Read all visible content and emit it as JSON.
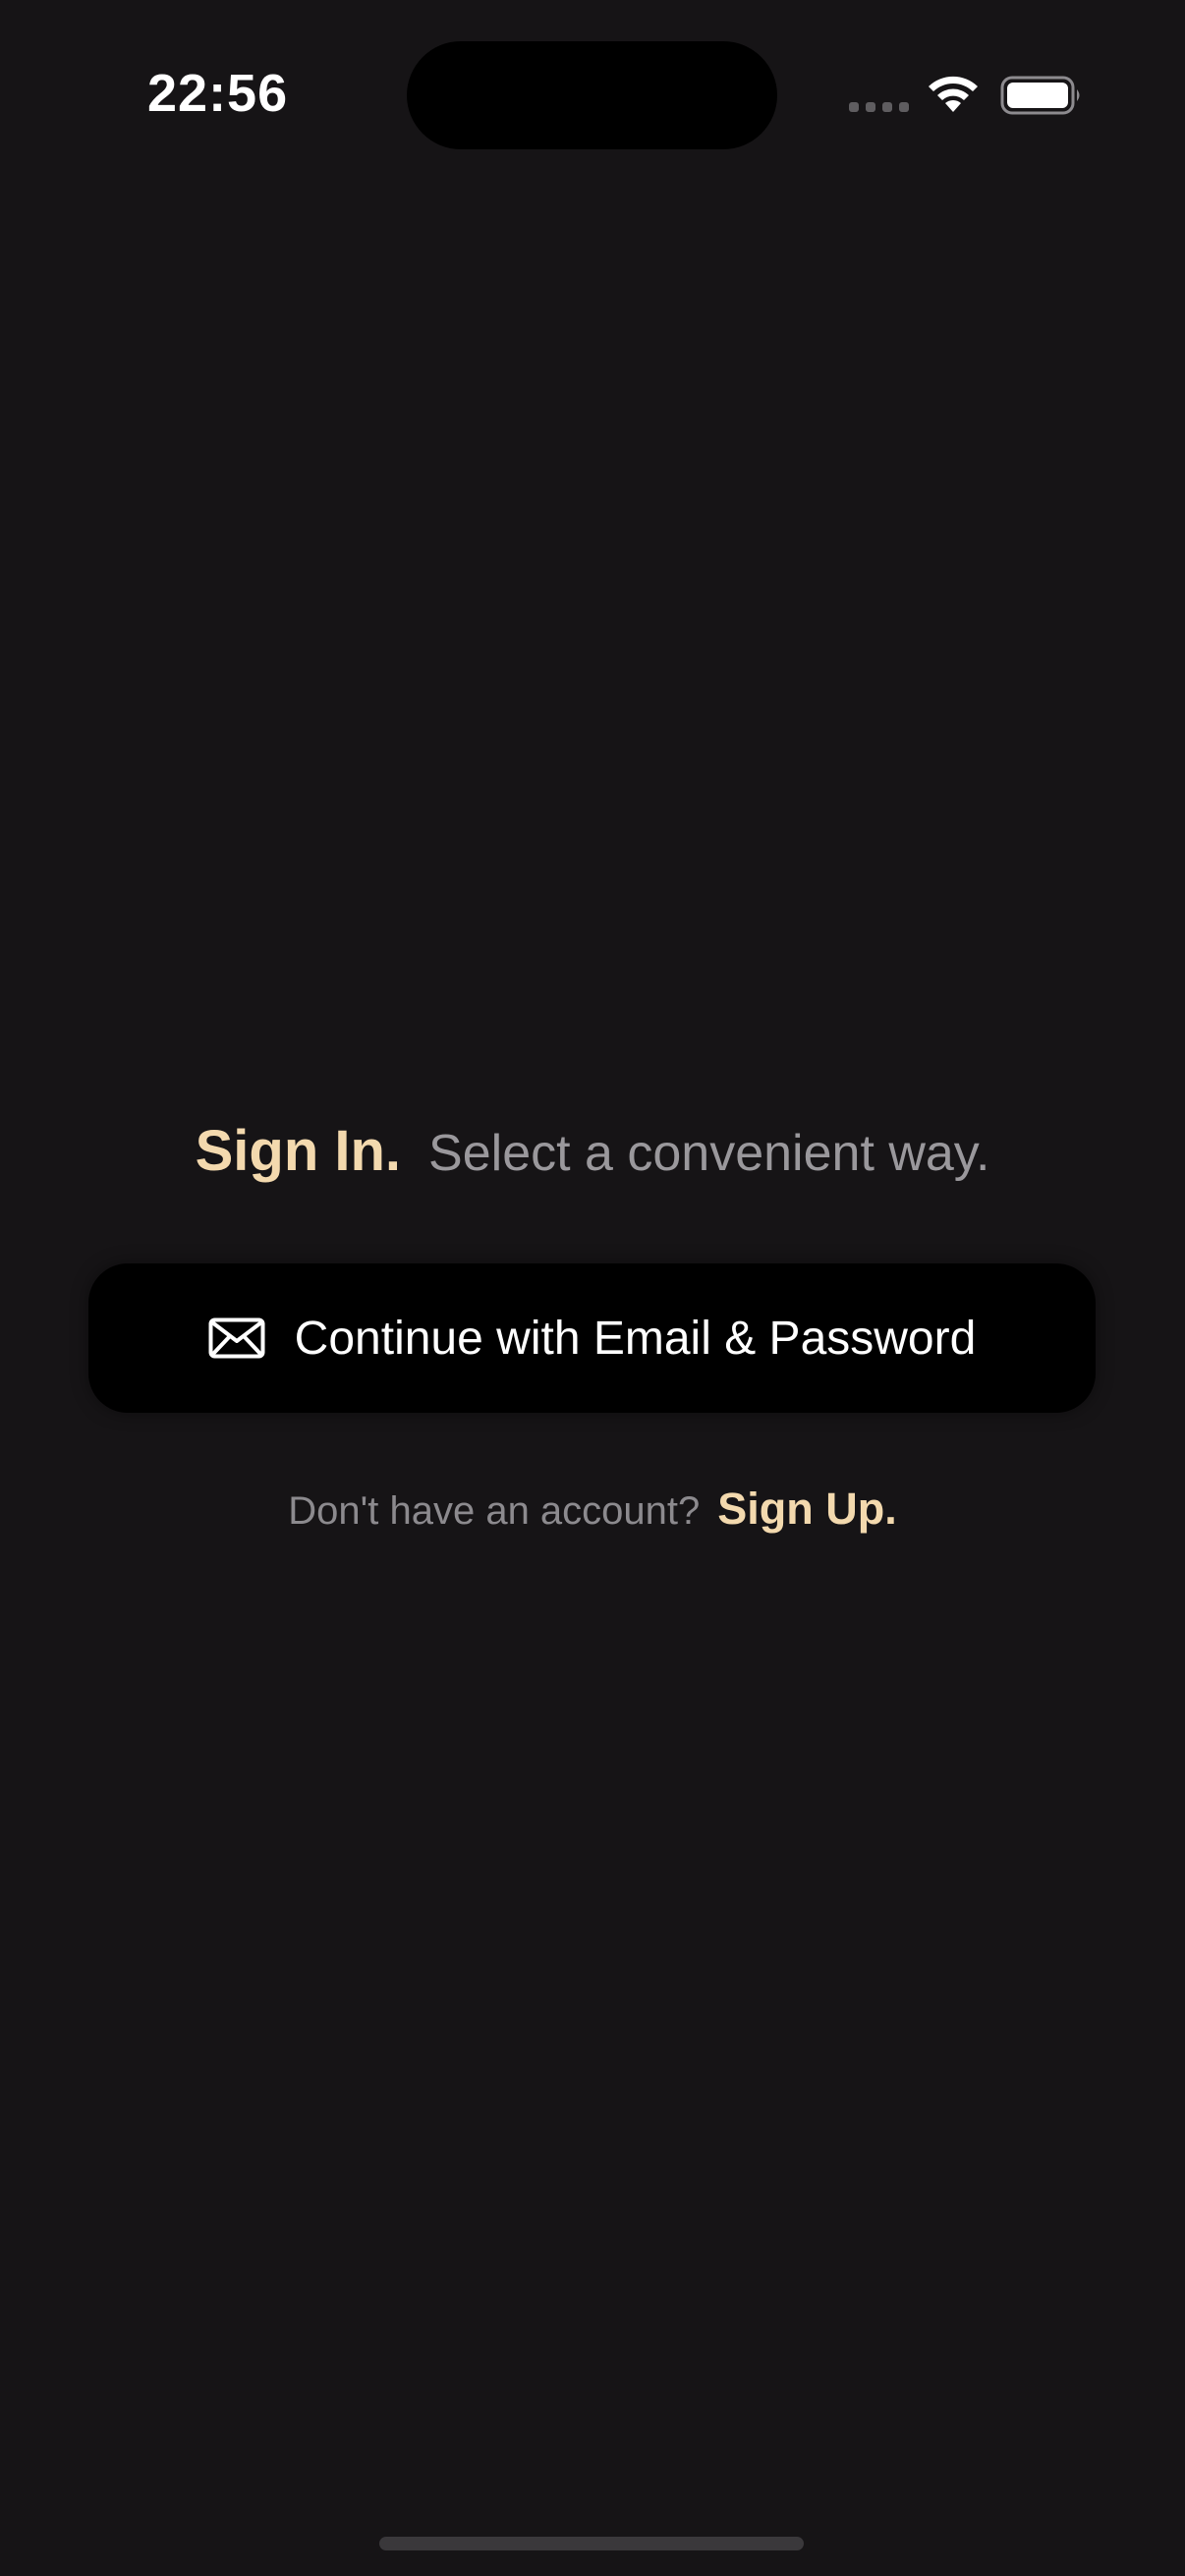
{
  "status_bar": {
    "time": "22:56",
    "icons": [
      "signal-icon",
      "wifi-icon",
      "battery-icon"
    ]
  },
  "sign_in": {
    "title": "Sign In.",
    "subtitle": "Select a convenient way."
  },
  "email_button": {
    "icon": "mail-icon",
    "label": "Continue with Email & Password"
  },
  "signup": {
    "prompt": "Don't have an account?",
    "link_label": "Sign Up."
  },
  "colors": {
    "background": "#161416",
    "accent": "#f3d9ae",
    "muted_text": "#9a989c",
    "button_bg": "#000000"
  }
}
